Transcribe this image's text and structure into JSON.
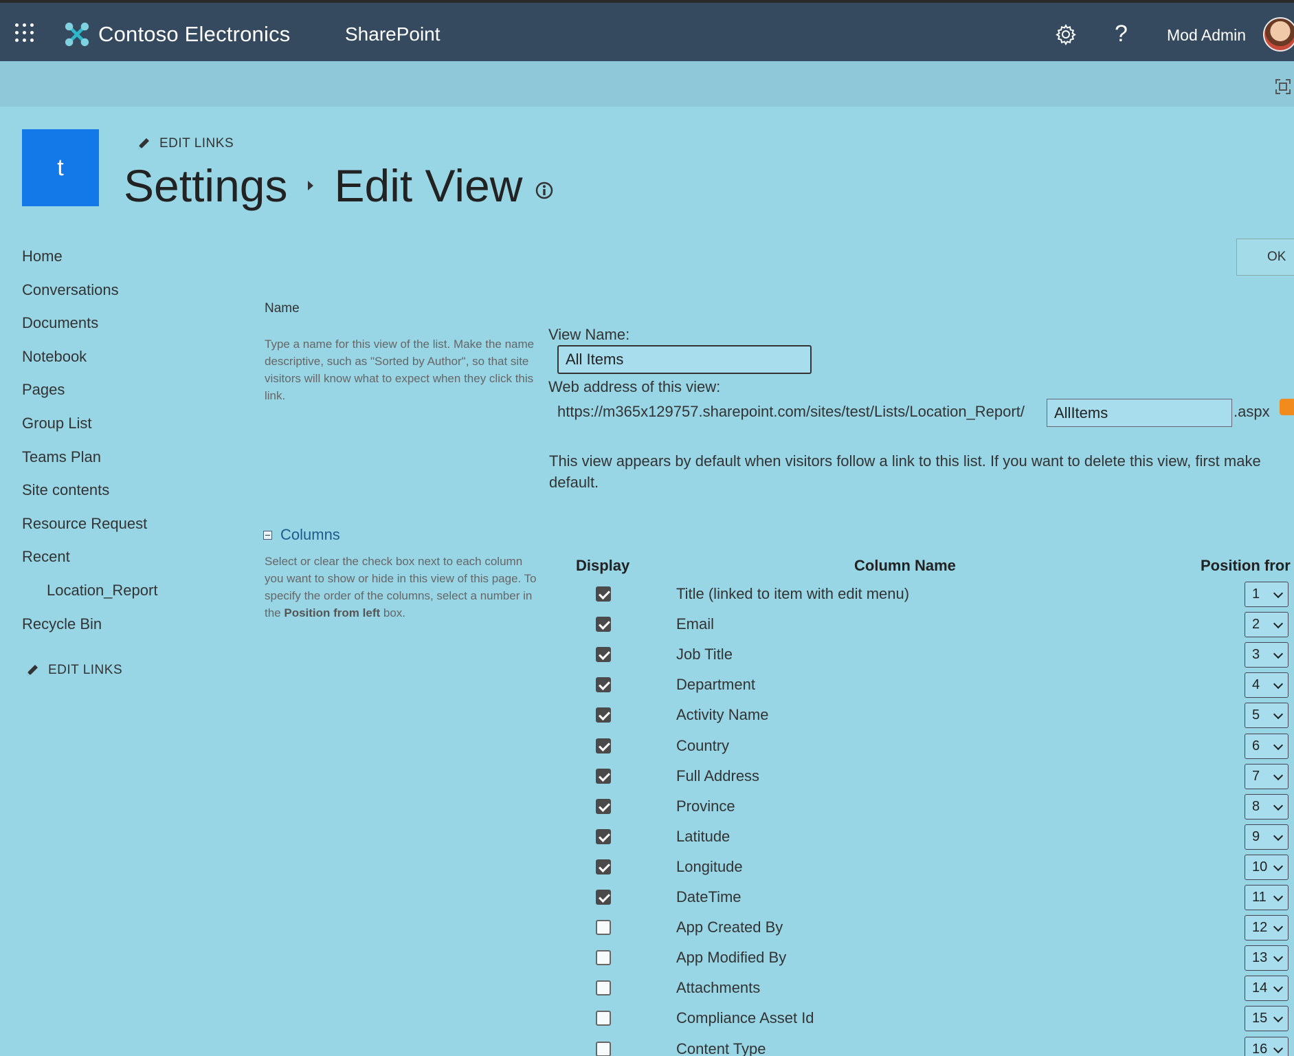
{
  "suitebar": {
    "brand": "Contoso Electronics",
    "app": "SharePoint",
    "user": "Mod Admin"
  },
  "site": {
    "logo_letter": "t",
    "edit_links": "EDIT LINKS",
    "breadcrumb_parent": "Settings",
    "page_title": "Edit View"
  },
  "nav": {
    "items": [
      {
        "label": "Home",
        "sub": false
      },
      {
        "label": "Conversations",
        "sub": false
      },
      {
        "label": "Documents",
        "sub": false
      },
      {
        "label": "Notebook",
        "sub": false
      },
      {
        "label": "Pages",
        "sub": false
      },
      {
        "label": "Group List",
        "sub": false
      },
      {
        "label": "Teams Plan",
        "sub": false
      },
      {
        "label": "Site contents",
        "sub": false
      },
      {
        "label": "Resource Request",
        "sub": false
      },
      {
        "label": "Recent",
        "sub": false
      },
      {
        "label": "Location_Report",
        "sub": true
      },
      {
        "label": "Recycle Bin",
        "sub": false
      }
    ],
    "edit_links": "EDIT LINKS"
  },
  "ok_label": "OK",
  "name_section": {
    "title": "Name",
    "description": "Type a name for this view of the list. Make the name descriptive, such as \"Sorted by Author\", so that site visitors will know what to expect when they click this link.",
    "view_name_label": "View Name:",
    "view_name_value": "All Items",
    "web_address_label": "Web address of this view:",
    "url_prefix": "https://m365x129757.sharepoint.com/sites/test/Lists/Location_Report/",
    "url_value": "AllItems",
    "url_suffix": ".aspx",
    "default_note_line1": "This view appears by default when visitors follow a link to this list. If you want to delete this view, first make",
    "default_note_line2": "default."
  },
  "columns_section": {
    "title": "Columns",
    "description_part1": "Select or clear the check box next to each column you want to show or hide in this view of this page. To specify the order of the columns, select a number in the ",
    "description_bold": "Position from left",
    "description_part2": " box.",
    "header_display": "Display",
    "header_column_name": "Column Name",
    "header_position": "Position fror",
    "rows": [
      {
        "name": "Title (linked to item with edit menu)",
        "checked": true,
        "position": "1"
      },
      {
        "name": "Email",
        "checked": true,
        "position": "2"
      },
      {
        "name": "Job Title",
        "checked": true,
        "position": "3"
      },
      {
        "name": "Department",
        "checked": true,
        "position": "4"
      },
      {
        "name": "Activity Name",
        "checked": true,
        "position": "5"
      },
      {
        "name": "Country",
        "checked": true,
        "position": "6"
      },
      {
        "name": "Full Address",
        "checked": true,
        "position": "7"
      },
      {
        "name": "Province",
        "checked": true,
        "position": "8"
      },
      {
        "name": "Latitude",
        "checked": true,
        "position": "9"
      },
      {
        "name": "Longitude",
        "checked": true,
        "position": "10"
      },
      {
        "name": "DateTime",
        "checked": true,
        "position": "11"
      },
      {
        "name": "App Created By",
        "checked": false,
        "position": "12"
      },
      {
        "name": "App Modified By",
        "checked": false,
        "position": "13"
      },
      {
        "name": "Attachments",
        "checked": false,
        "position": "14"
      },
      {
        "name": "Compliance Asset Id",
        "checked": false,
        "position": "15"
      },
      {
        "name": "Content Type",
        "checked": false,
        "position": "16"
      }
    ]
  },
  "colors": {
    "suitebar": "#354a5f",
    "page_background": "#98d6e6",
    "site_logo": "#1479e8",
    "link_blue": "#1d5b8c"
  },
  "icons": [
    "waffle-icon",
    "contoso-logo-icon",
    "gear-icon",
    "help-icon",
    "focus-mode-icon",
    "pencil-icon",
    "info-icon",
    "rss-icon",
    "collapse-icon",
    "chevron-down-icon"
  ]
}
